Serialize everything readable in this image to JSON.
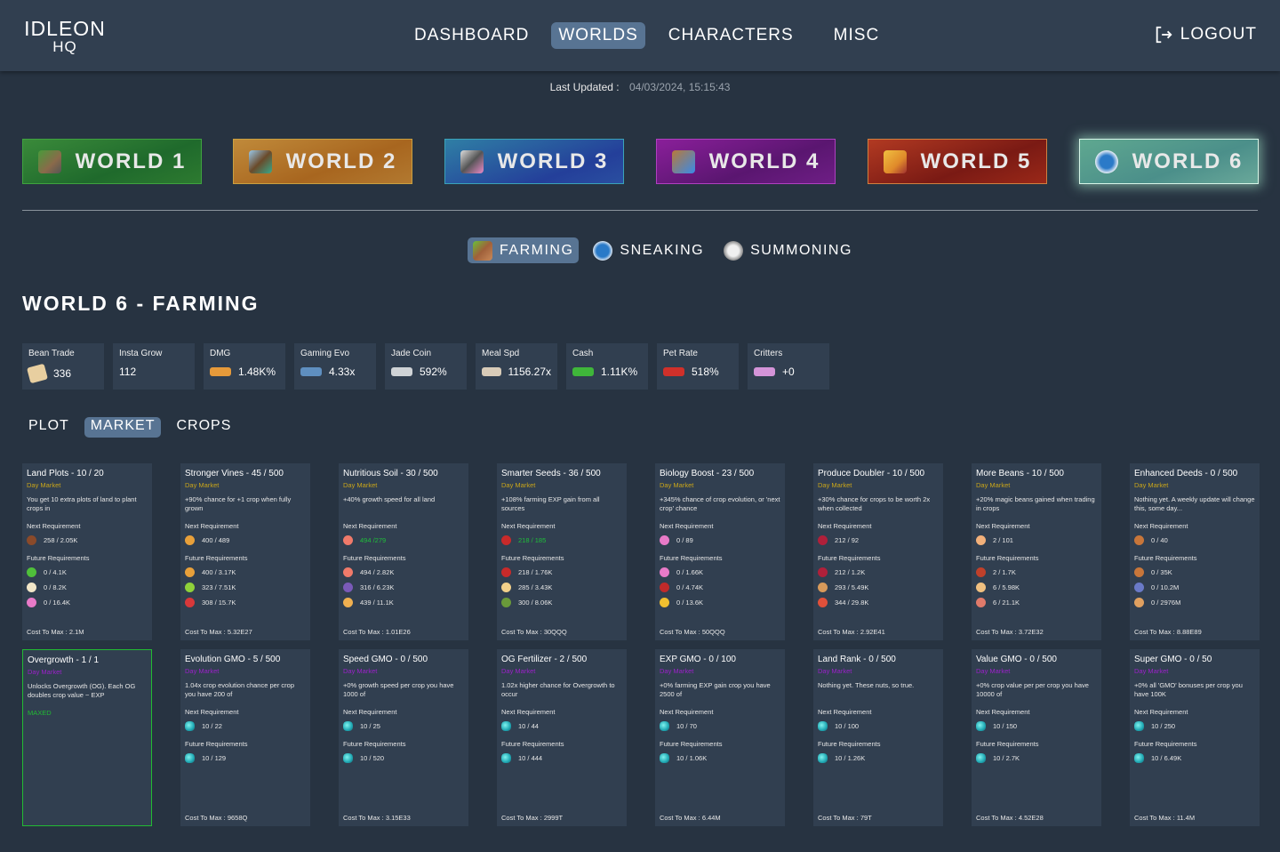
{
  "header": {
    "logo_line1": "IDLEON",
    "logo_line2": "HQ",
    "nav": [
      {
        "label": "DASHBOARD",
        "active": false
      },
      {
        "label": "WORLDS",
        "active": true
      },
      {
        "label": "CHARACTERS",
        "active": false
      },
      {
        "label": "MISC",
        "active": false
      }
    ],
    "logout_label": "LOGOUT",
    "logout_icon": "logout-icon"
  },
  "last_updated": {
    "label": "Last Updated :",
    "value": "04/03/2024, 15:15:43"
  },
  "worlds": [
    {
      "label": "WORLD 1",
      "icon": "world1-icon"
    },
    {
      "label": "WORLD 2",
      "icon": "world2-icon"
    },
    {
      "label": "WORLD 3",
      "icon": "world3-icon"
    },
    {
      "label": "WORLD 4",
      "icon": "world4-icon"
    },
    {
      "label": "WORLD 5",
      "icon": "world5-icon"
    },
    {
      "label": "WORLD 6",
      "icon": "world6-icon",
      "active": true
    }
  ],
  "skill_tabs": [
    {
      "label": "FARMING",
      "icon": "farming-icon",
      "active": true
    },
    {
      "label": "SNEAKING",
      "icon": "sneaking-icon"
    },
    {
      "label": "SUMMONING",
      "icon": "summoning-icon"
    }
  ],
  "page_title": "WORLD 6 - FARMING",
  "stats": [
    {
      "name": "Bean Trade",
      "value": "336",
      "icon": "bean-trade-icon",
      "color": "#e8cfa0"
    },
    {
      "name": "Insta Grow",
      "value": "112",
      "icon": ""
    },
    {
      "name": "DMG",
      "value": "1.48K%",
      "icon": "dmg-icon",
      "color": "#e69a3a"
    },
    {
      "name": "Gaming Evo",
      "value": "4.33x",
      "icon": "gaming-evo-icon",
      "color": "#5f8fc0"
    },
    {
      "name": "Jade Coin",
      "value": "592%",
      "icon": "jade-coin-icon",
      "color": "#cfd3d6"
    },
    {
      "name": "Meal Spd",
      "value": "1156.27x",
      "icon": "meal-spd-icon",
      "color": "#d8cbb8"
    },
    {
      "name": "Cash",
      "value": "1.11K%",
      "icon": "cash-icon",
      "color": "#3fb63a"
    },
    {
      "name": "Pet Rate",
      "value": "518%",
      "icon": "pet-rate-icon",
      "color": "#d0302a"
    },
    {
      "name": "Critters",
      "value": "+0",
      "icon": "critters-icon",
      "color": "#d494d8"
    }
  ],
  "sub_tabs": [
    {
      "label": "PLOT",
      "active": false
    },
    {
      "label": "MARKET",
      "active": true
    },
    {
      "label": "CROPS",
      "active": false
    }
  ],
  "labels": {
    "next_requirement": "Next Requirement",
    "future_requirements": "Future Requirements",
    "cost_to_max": "Cost To Max :"
  },
  "cards": [
    {
      "title": "Land Plots - 10 / 20",
      "market": "Day Market",
      "type": "day",
      "desc": "You get 10 extra plots of land to plant crops in",
      "next": {
        "icon": "crop-icon",
        "color": "#8a4a2a",
        "value": "258 / 2.05K",
        "met": false
      },
      "future": [
        {
          "icon": "crop-icon",
          "color": "#4fbf3a",
          "value": "0 / 4.1K"
        },
        {
          "icon": "crop-icon",
          "color": "#f2e6c8",
          "value": "0 / 8.2K"
        },
        {
          "icon": "crop-icon",
          "color": "#e87ac8",
          "value": "0 / 16.4K"
        }
      ],
      "cost": "2.1M"
    },
    {
      "title": "Stronger Vines - 45 / 500",
      "market": "Day Market",
      "type": "day",
      "desc": "+90% chance for +1 crop when fully grown",
      "next": {
        "icon": "crop-icon",
        "color": "#e8a03a",
        "value": "400 / 489",
        "met": false
      },
      "future": [
        {
          "icon": "crop-icon",
          "color": "#e8a03a",
          "value": "400 / 3.17K"
        },
        {
          "icon": "crop-icon",
          "color": "#8fd13a",
          "value": "323 / 7.51K"
        },
        {
          "icon": "crop-icon",
          "color": "#d8383a",
          "value": "308 / 15.7K"
        }
      ],
      "cost": "5.32E27"
    },
    {
      "title": "Nutritious Soil - 30 / 500",
      "market": "Day Market",
      "type": "day",
      "desc": "+40% growth speed for all land",
      "next": {
        "icon": "crop-icon",
        "color": "#f07a6a",
        "value": "494 /279",
        "met": true
      },
      "future": [
        {
          "icon": "crop-icon",
          "color": "#f07a6a",
          "value": "494 / 2.82K"
        },
        {
          "icon": "crop-icon",
          "color": "#7a5ab8",
          "value": "316 / 6.23K"
        },
        {
          "icon": "crop-icon",
          "color": "#f0b050",
          "value": "439 / 11.1K"
        }
      ],
      "cost": "1.01E26"
    },
    {
      "title": "Smarter Seeds - 36 / 500",
      "market": "Day Market",
      "type": "day",
      "desc": "+108% farming EXP gain from all sources",
      "next": {
        "icon": "crop-icon",
        "color": "#c82a2a",
        "value": "218 / 185",
        "met": true
      },
      "future": [
        {
          "icon": "crop-icon",
          "color": "#c82a2a",
          "value": "218 / 1.76K"
        },
        {
          "icon": "crop-icon",
          "color": "#f2d08a",
          "value": "285 / 3.43K"
        },
        {
          "icon": "crop-icon",
          "color": "#6a9a3a",
          "value": "300 / 8.06K"
        }
      ],
      "cost": "30QQQ"
    },
    {
      "title": "Biology Boost - 23 / 500",
      "market": "Day Market",
      "type": "day",
      "desc": "+345% chance of crop evolution, or 'next crop' chance",
      "next": {
        "icon": "crop-icon",
        "color": "#e87ac8",
        "value": "0 / 89",
        "met": false
      },
      "future": [
        {
          "icon": "crop-icon",
          "color": "#e87ac8",
          "value": "0 / 1.66K"
        },
        {
          "icon": "crop-icon",
          "color": "#c02a2a",
          "value": "0 / 4.74K"
        },
        {
          "icon": "crop-icon",
          "color": "#f0c030",
          "value": "0 / 13.6K"
        }
      ],
      "cost": "50QQQ"
    },
    {
      "title": "Produce Doubler - 10 / 500",
      "market": "Day Market",
      "type": "day",
      "desc": "+30% chance for crops to be worth 2x when collected",
      "next": {
        "icon": "crop-icon",
        "color": "#b0203a",
        "value": "212 / 92",
        "met": false
      },
      "future": [
        {
          "icon": "crop-icon",
          "color": "#b0203a",
          "value": "212 / 1.2K"
        },
        {
          "icon": "crop-icon",
          "color": "#d89a5a",
          "value": "293 / 5.49K"
        },
        {
          "icon": "crop-icon",
          "color": "#e0503a",
          "value": "344 / 29.8K"
        }
      ],
      "cost": "2.92E41"
    },
    {
      "title": "More Beans - 10 / 500",
      "market": "Day Market",
      "type": "day",
      "desc": "+20% magic beans gained when trading in crops",
      "next": {
        "icon": "crop-icon",
        "color": "#f2b07a",
        "value": "2 / 101",
        "met": false
      },
      "future": [
        {
          "icon": "crop-icon",
          "color": "#c0402a",
          "value": "2 / 1.7K"
        },
        {
          "icon": "crop-icon",
          "color": "#f0c080",
          "value": "6 / 5.98K"
        },
        {
          "icon": "crop-icon",
          "color": "#e07a6a",
          "value": "6 / 21.1K"
        }
      ],
      "cost": "3.72E32"
    },
    {
      "title": "Enhanced Deeds - 0 / 500",
      "market": "Day Market",
      "type": "day",
      "desc": "Nothing yet. A weekly update will change this, some day...",
      "next": {
        "icon": "crop-icon",
        "color": "#c8763a",
        "value": "0 / 40",
        "met": false
      },
      "future": [
        {
          "icon": "crop-icon",
          "color": "#c8763a",
          "value": "0 / 35K"
        },
        {
          "icon": "crop-icon",
          "color": "#6a7ac8",
          "value": "0 / 10.2M"
        },
        {
          "icon": "crop-icon",
          "color": "#e0a060",
          "value": "0 / 2976M"
        }
      ],
      "cost": "8.88E89"
    },
    {
      "title": "Overgrowth - 1 / 1",
      "market": "Day Market",
      "type": "night",
      "desc": "Unlocks Overgrowth (OG). Each OG doubles crop value ~ EXP",
      "maxed": "MAXED"
    },
    {
      "title": "Evolution GMO - 5 / 500",
      "market": "Day Market",
      "type": "night",
      "desc": "1.04x crop evolution chance per crop you have 200 of",
      "next": {
        "icon": "gmo-icon",
        "value": "10 / 22",
        "met": false
      },
      "future": [
        {
          "icon": "gmo-icon",
          "value": "10 / 129"
        }
      ],
      "cost": "9658Q"
    },
    {
      "title": "Speed GMO - 0 / 500",
      "market": "Day Market",
      "type": "night",
      "desc": "+0% growth speed per crop you have 1000 of",
      "next": {
        "icon": "gmo-icon",
        "value": "10 / 25",
        "met": false
      },
      "future": [
        {
          "icon": "gmo-icon",
          "value": "10 / 520"
        }
      ],
      "cost": "3.15E33"
    },
    {
      "title": "OG Fertilizer - 2 / 500",
      "market": "Day Market",
      "type": "night",
      "desc": "1.02x higher chance for Overgrowth to occur",
      "next": {
        "icon": "gmo-icon",
        "value": "10 / 44",
        "met": false
      },
      "future": [
        {
          "icon": "gmo-icon",
          "value": "10 / 444"
        }
      ],
      "cost": "2999T"
    },
    {
      "title": "EXP GMO - 0 / 100",
      "market": "Day Market",
      "type": "night",
      "desc": "+0% farming EXP gain crop you have 2500 of",
      "next": {
        "icon": "gmo-icon",
        "value": "10 / 70",
        "met": false
      },
      "future": [
        {
          "icon": "gmo-icon",
          "value": "10 / 1.06K"
        }
      ],
      "cost": "6.44M"
    },
    {
      "title": "Land Rank - 0 / 500",
      "market": "Day Market",
      "type": "night",
      "desc": "Nothing yet. These nuts, so true.",
      "next": {
        "icon": "gmo-icon",
        "value": "10 / 100",
        "met": false
      },
      "future": [
        {
          "icon": "gmo-icon",
          "value": "10 / 1.26K"
        }
      ],
      "cost": "79T"
    },
    {
      "title": "Value GMO - 0 / 500",
      "market": "Day Market",
      "type": "night",
      "desc": "+0% crop value per per crop you have 10000 of",
      "next": {
        "icon": "gmo-icon",
        "value": "10 / 150",
        "met": false
      },
      "future": [
        {
          "icon": "gmo-icon",
          "value": "10 / 2.7K"
        }
      ],
      "cost": "4.52E28"
    },
    {
      "title": "Super GMO - 0 / 50",
      "market": "Day Market",
      "type": "night",
      "desc": "+0% all 'GMO' bonuses per crop you have 100K",
      "next": {
        "icon": "gmo-icon",
        "value": "10 / 250",
        "met": false
      },
      "future": [
        {
          "icon": "gmo-icon",
          "value": "10 / 6.49K"
        }
      ],
      "cost": "11.4M"
    }
  ]
}
